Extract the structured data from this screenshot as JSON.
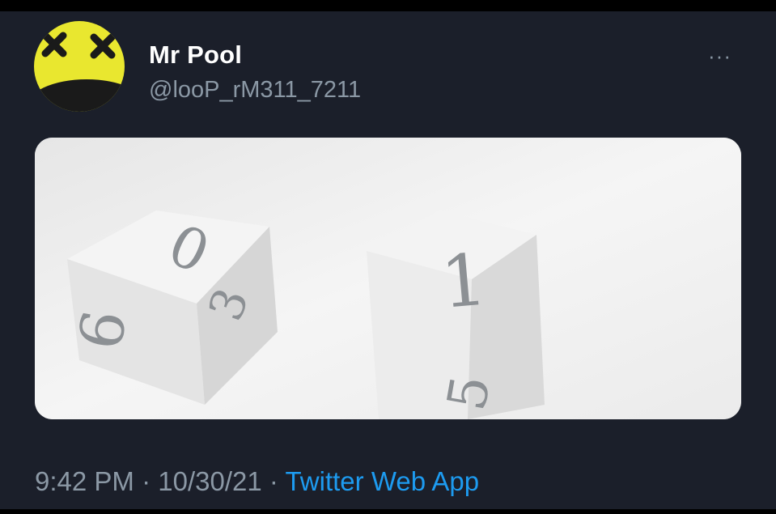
{
  "tweet": {
    "display_name": "Mr Pool",
    "handle": "@looP_rM311_7211",
    "more_label": "···",
    "time": "9:42 PM",
    "separator": "·",
    "date": "10/30/21",
    "source": "Twitter Web App"
  },
  "media": {
    "die_left_top": "0",
    "die_left_front": "6",
    "die_left_side": "3",
    "die_right_top": "1",
    "die_right_front": "5"
  },
  "colors": {
    "background": "#1b1f2a",
    "text_primary": "#ffffff",
    "text_secondary": "#8b98a5",
    "link": "#1d9bf0",
    "avatar_yellow": "#e9e72f"
  }
}
